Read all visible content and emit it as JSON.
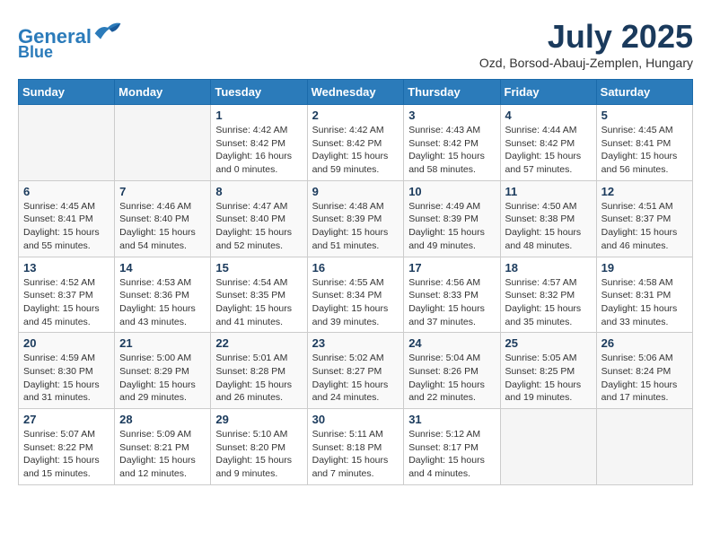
{
  "header": {
    "logo_line1": "General",
    "logo_line2": "Blue",
    "month": "July 2025",
    "location": "Ozd, Borsod-Abauj-Zemplen, Hungary"
  },
  "weekdays": [
    "Sunday",
    "Monday",
    "Tuesday",
    "Wednesday",
    "Thursday",
    "Friday",
    "Saturday"
  ],
  "weeks": [
    [
      {
        "day": "",
        "info": ""
      },
      {
        "day": "",
        "info": ""
      },
      {
        "day": "1",
        "info": "Sunrise: 4:42 AM\nSunset: 8:42 PM\nDaylight: 16 hours\nand 0 minutes."
      },
      {
        "day": "2",
        "info": "Sunrise: 4:42 AM\nSunset: 8:42 PM\nDaylight: 15 hours\nand 59 minutes."
      },
      {
        "day": "3",
        "info": "Sunrise: 4:43 AM\nSunset: 8:42 PM\nDaylight: 15 hours\nand 58 minutes."
      },
      {
        "day": "4",
        "info": "Sunrise: 4:44 AM\nSunset: 8:42 PM\nDaylight: 15 hours\nand 57 minutes."
      },
      {
        "day": "5",
        "info": "Sunrise: 4:45 AM\nSunset: 8:41 PM\nDaylight: 15 hours\nand 56 minutes."
      }
    ],
    [
      {
        "day": "6",
        "info": "Sunrise: 4:45 AM\nSunset: 8:41 PM\nDaylight: 15 hours\nand 55 minutes."
      },
      {
        "day": "7",
        "info": "Sunrise: 4:46 AM\nSunset: 8:40 PM\nDaylight: 15 hours\nand 54 minutes."
      },
      {
        "day": "8",
        "info": "Sunrise: 4:47 AM\nSunset: 8:40 PM\nDaylight: 15 hours\nand 52 minutes."
      },
      {
        "day": "9",
        "info": "Sunrise: 4:48 AM\nSunset: 8:39 PM\nDaylight: 15 hours\nand 51 minutes."
      },
      {
        "day": "10",
        "info": "Sunrise: 4:49 AM\nSunset: 8:39 PM\nDaylight: 15 hours\nand 49 minutes."
      },
      {
        "day": "11",
        "info": "Sunrise: 4:50 AM\nSunset: 8:38 PM\nDaylight: 15 hours\nand 48 minutes."
      },
      {
        "day": "12",
        "info": "Sunrise: 4:51 AM\nSunset: 8:37 PM\nDaylight: 15 hours\nand 46 minutes."
      }
    ],
    [
      {
        "day": "13",
        "info": "Sunrise: 4:52 AM\nSunset: 8:37 PM\nDaylight: 15 hours\nand 45 minutes."
      },
      {
        "day": "14",
        "info": "Sunrise: 4:53 AM\nSunset: 8:36 PM\nDaylight: 15 hours\nand 43 minutes."
      },
      {
        "day": "15",
        "info": "Sunrise: 4:54 AM\nSunset: 8:35 PM\nDaylight: 15 hours\nand 41 minutes."
      },
      {
        "day": "16",
        "info": "Sunrise: 4:55 AM\nSunset: 8:34 PM\nDaylight: 15 hours\nand 39 minutes."
      },
      {
        "day": "17",
        "info": "Sunrise: 4:56 AM\nSunset: 8:33 PM\nDaylight: 15 hours\nand 37 minutes."
      },
      {
        "day": "18",
        "info": "Sunrise: 4:57 AM\nSunset: 8:32 PM\nDaylight: 15 hours\nand 35 minutes."
      },
      {
        "day": "19",
        "info": "Sunrise: 4:58 AM\nSunset: 8:31 PM\nDaylight: 15 hours\nand 33 minutes."
      }
    ],
    [
      {
        "day": "20",
        "info": "Sunrise: 4:59 AM\nSunset: 8:30 PM\nDaylight: 15 hours\nand 31 minutes."
      },
      {
        "day": "21",
        "info": "Sunrise: 5:00 AM\nSunset: 8:29 PM\nDaylight: 15 hours\nand 29 minutes."
      },
      {
        "day": "22",
        "info": "Sunrise: 5:01 AM\nSunset: 8:28 PM\nDaylight: 15 hours\nand 26 minutes."
      },
      {
        "day": "23",
        "info": "Sunrise: 5:02 AM\nSunset: 8:27 PM\nDaylight: 15 hours\nand 24 minutes."
      },
      {
        "day": "24",
        "info": "Sunrise: 5:04 AM\nSunset: 8:26 PM\nDaylight: 15 hours\nand 22 minutes."
      },
      {
        "day": "25",
        "info": "Sunrise: 5:05 AM\nSunset: 8:25 PM\nDaylight: 15 hours\nand 19 minutes."
      },
      {
        "day": "26",
        "info": "Sunrise: 5:06 AM\nSunset: 8:24 PM\nDaylight: 15 hours\nand 17 minutes."
      }
    ],
    [
      {
        "day": "27",
        "info": "Sunrise: 5:07 AM\nSunset: 8:22 PM\nDaylight: 15 hours\nand 15 minutes."
      },
      {
        "day": "28",
        "info": "Sunrise: 5:09 AM\nSunset: 8:21 PM\nDaylight: 15 hours\nand 12 minutes."
      },
      {
        "day": "29",
        "info": "Sunrise: 5:10 AM\nSunset: 8:20 PM\nDaylight: 15 hours\nand 9 minutes."
      },
      {
        "day": "30",
        "info": "Sunrise: 5:11 AM\nSunset: 8:18 PM\nDaylight: 15 hours\nand 7 minutes."
      },
      {
        "day": "31",
        "info": "Sunrise: 5:12 AM\nSunset: 8:17 PM\nDaylight: 15 hours\nand 4 minutes."
      },
      {
        "day": "",
        "info": ""
      },
      {
        "day": "",
        "info": ""
      }
    ]
  ]
}
